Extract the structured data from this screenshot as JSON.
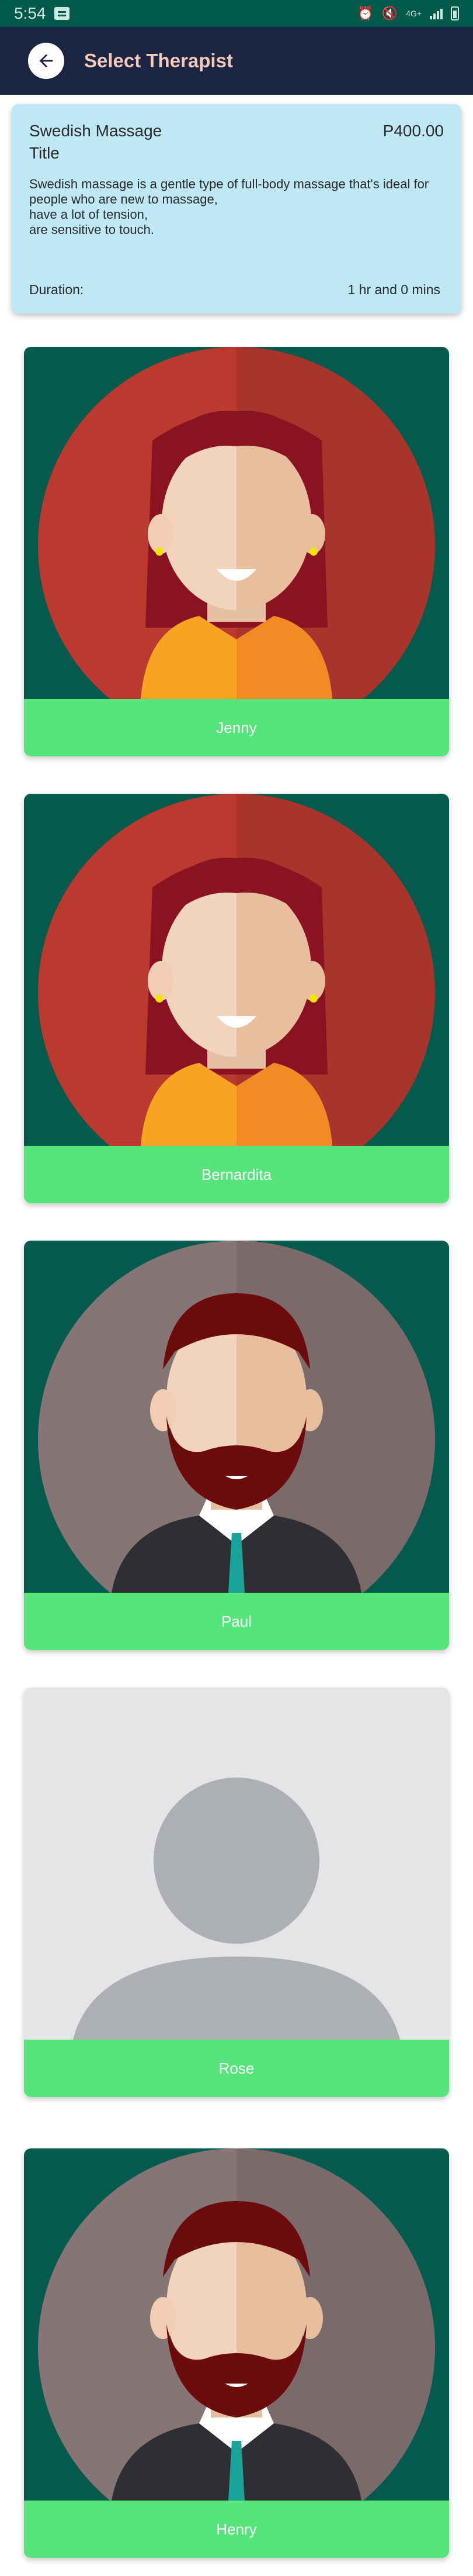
{
  "status_bar": {
    "time": "5:54",
    "lte": "4G+"
  },
  "app_bar": {
    "title": "Select Therapist"
  },
  "service": {
    "name": "Swedish Massage",
    "price": "P400.00",
    "subtitle": "Title",
    "description": "Swedish massage is a gentle type of full-body massage that's ideal for people who are new to massage,\nhave a lot of tension,\nare sensitive to touch.",
    "duration_label": "Duration:",
    "duration_value": "1 hr and 0 mins"
  },
  "therapists": [
    {
      "name": "Jenny",
      "avatar": "female-avatar"
    },
    {
      "name": "Bernardita",
      "avatar": "female-avatar"
    },
    {
      "name": "Paul",
      "avatar": "male-avatar"
    },
    {
      "name": "Rose",
      "avatar": "placeholder-avatar"
    },
    {
      "name": "Henry",
      "avatar": "male-avatar"
    }
  ],
  "colors": {
    "status_bar": "#005a4c",
    "app_bar": "#1c2444",
    "title_text": "#f4cbb6",
    "service_card": "#bfe8f6",
    "name_bar": "#55e57b"
  }
}
